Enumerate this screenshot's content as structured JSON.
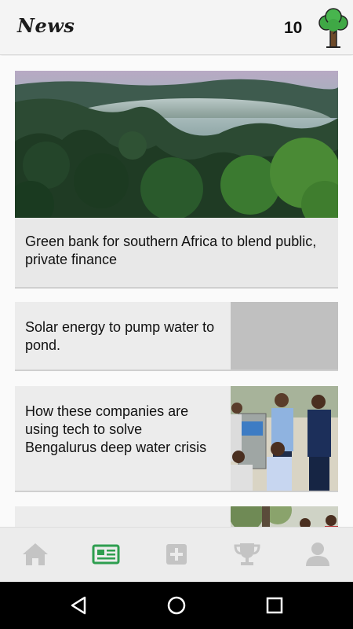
{
  "app_bar": {
    "title": "News",
    "score": "10",
    "icon": "tree-icon"
  },
  "feed": {
    "articles": [
      {
        "title": "Green bank for southern Africa to blend public, private finance",
        "image": "misty-rainforest-photo"
      },
      {
        "title": "Solar energy to pump water to pond.",
        "image": "placeholder-gray"
      },
      {
        "title": "How these companies are using tech to solve Bengalurus deep water crisis",
        "image": "team-photo"
      },
      {
        "title": "",
        "image": "outdoor-photo"
      }
    ]
  },
  "bottom_nav": {
    "items": [
      {
        "icon": "home-icon",
        "active": false
      },
      {
        "icon": "news-icon",
        "active": true
      },
      {
        "icon": "add-icon",
        "active": false
      },
      {
        "icon": "trophy-icon",
        "active": false
      },
      {
        "icon": "profile-icon",
        "active": false
      }
    ],
    "active_color": "#2e9e4f",
    "inactive_color": "#c4c4c4"
  },
  "system_nav": {
    "items": [
      "back-icon",
      "home-circle-icon",
      "recents-icon"
    ]
  }
}
